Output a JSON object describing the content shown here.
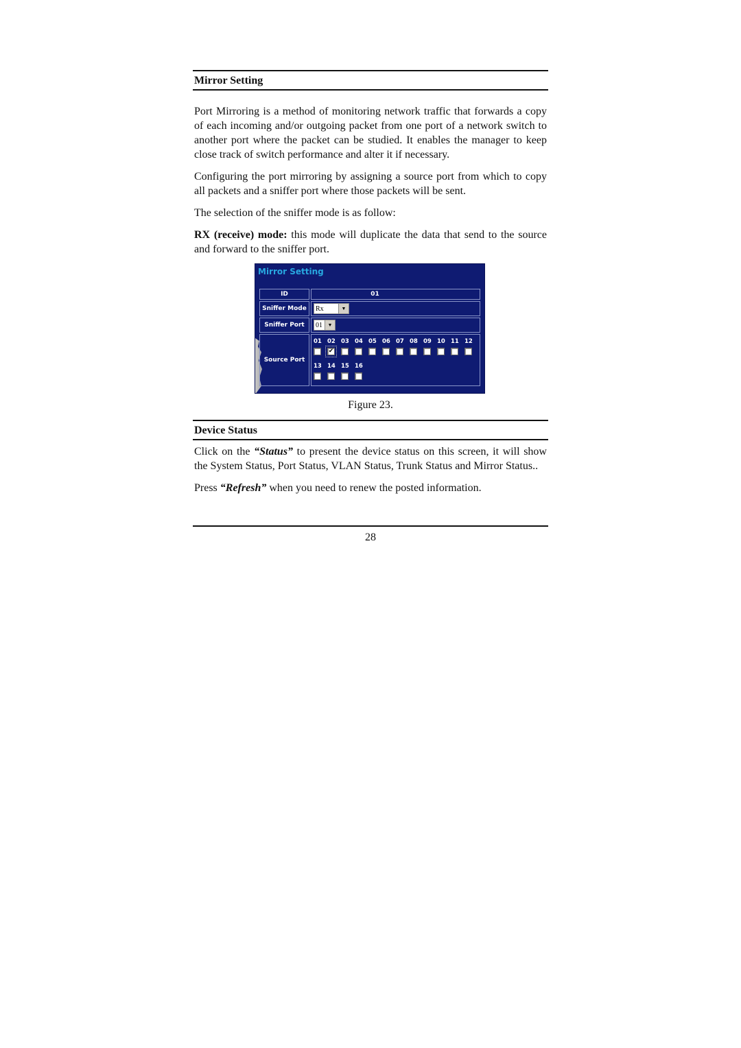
{
  "section1": {
    "heading": "Mirror Setting",
    "paragraphs": [
      "Port Mirroring is a method of monitoring network traffic that forwards a copy of each incoming and/or outgoing packet from one port of a network switch to another port where the packet can be studied. It enables the manager to keep close track of switch performance and alter it if necessary.",
      "Configuring the port mirroring by assigning a source port from which to copy all packets and a sniffer port where those packets will be sent.",
      "The selection of the sniffer mode is as follow:"
    ],
    "rx_mode": {
      "label": "RX (receive) mode:",
      "text": " this mode will duplicate the data that send to the source and forward to the sniffer port."
    }
  },
  "figure": {
    "title": "Mirror Setting",
    "rows": {
      "id_label": "ID",
      "id_value": "01",
      "sniffer_mode_label": "Sniffer Mode",
      "sniffer_mode_value": "Rx",
      "sniffer_port_label": "Sniffer Port",
      "sniffer_port_value": "01",
      "source_port_label": "Source Port"
    },
    "source_ports": [
      {
        "num": "01",
        "checked": false
      },
      {
        "num": "02",
        "checked": true
      },
      {
        "num": "03",
        "checked": false
      },
      {
        "num": "04",
        "checked": false
      },
      {
        "num": "05",
        "checked": false
      },
      {
        "num": "06",
        "checked": false
      },
      {
        "num": "07",
        "checked": false
      },
      {
        "num": "08",
        "checked": false
      },
      {
        "num": "09",
        "checked": false
      },
      {
        "num": "10",
        "checked": false
      },
      {
        "num": "11",
        "checked": false
      },
      {
        "num": "12",
        "checked": false
      },
      {
        "num": "13",
        "checked": false
      },
      {
        "num": "14",
        "checked": false
      },
      {
        "num": "15",
        "checked": false
      },
      {
        "num": "16",
        "checked": false
      }
    ],
    "caption": "Figure 23."
  },
  "section2": {
    "heading": "Device Status",
    "p1_before": "Click on the ",
    "p1_em": "“Status”",
    "p1_after": " to present the device status on this screen, it will show the System Status, Port Status, VLAN Status, Trunk Status and Mirror Status..",
    "p2_before": "Press ",
    "p2_em": "“Refresh”",
    "p2_after": " when you need to renew the posted information."
  },
  "footer": {
    "page_number": "28"
  }
}
